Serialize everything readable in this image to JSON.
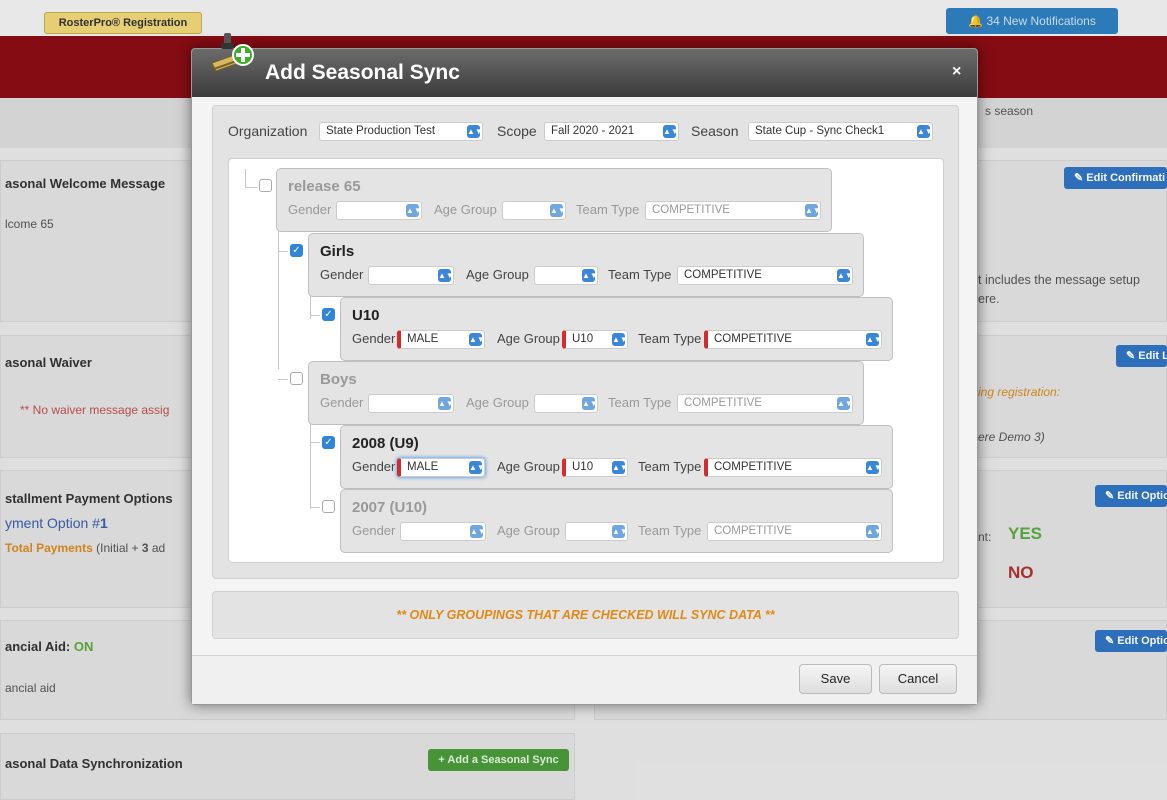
{
  "page": {
    "registration_tab": "RosterPro® Registration",
    "notifications": "34 New Notifications",
    "season_text": "s season",
    "welcome_title": "asonal Welcome Message",
    "welcome_text": "lcome 65",
    "waiver_title": "asonal Waiver",
    "waiver_text": "** No waiver message assig",
    "installment_title": "stallment Payment Options",
    "payment_option": "yment Option #",
    "payment_option_num": "1",
    "total_payments_label": "Total Payments",
    "total_payments_rest": " (Initial + ",
    "total_payments_num": "3",
    "total_payments_tail": " ad",
    "aid_title": "ancial Aid: ",
    "aid_status": "ON",
    "aid_text": "ancial aid",
    "sync_title": "asonal Data Synchronization",
    "add_sync_button": "+ Add a Seasonal Sync",
    "edit_confirmation": "Edit Confirmati",
    "edit_waiver": "Edit L",
    "edit_options1": "Edit Optio",
    "edit_options2": "Edit Optio",
    "right_text1": "t includes the message setup",
    "right_text2": "ere.",
    "right_italic": "ing registration:",
    "right_demo": "ere Demo 3)",
    "right_nt": "nt:",
    "right_yes": "YES",
    "right_no": "NO"
  },
  "modal": {
    "title": "Add Seasonal Sync",
    "close": "×",
    "organization_label": "Organization",
    "organization_value": "State Production Test",
    "scope_label": "Scope",
    "scope_value": "Fall 2020 - 2021",
    "season_label": "Season",
    "season_value": "State Cup - Sync Check1",
    "gender_label": "Gender",
    "age_label": "Age Group",
    "type_label": "Team Type",
    "nodes": [
      {
        "name": "release 65",
        "checked": false,
        "gender": "",
        "age": "",
        "type": "COMPETITIVE"
      },
      {
        "name": "Girls",
        "checked": true,
        "gender": "",
        "age": "",
        "type": "COMPETITIVE"
      },
      {
        "name": "U10",
        "checked": true,
        "gender": "MALE",
        "age": "U10",
        "type": "COMPETITIVE"
      },
      {
        "name": "Boys",
        "checked": false,
        "gender": "",
        "age": "",
        "type": "COMPETITIVE"
      },
      {
        "name": "2008 (U9)",
        "checked": true,
        "gender": "MALE",
        "age": "U10",
        "type": "COMPETITIVE"
      },
      {
        "name": "2007 (U10)",
        "checked": false,
        "gender": "",
        "age": "",
        "type": "COMPETITIVE"
      }
    ],
    "warning": "** ONLY GROUPINGS THAT ARE CHECKED WILL SYNC DATA **",
    "save": "Save",
    "cancel": "Cancel"
  }
}
